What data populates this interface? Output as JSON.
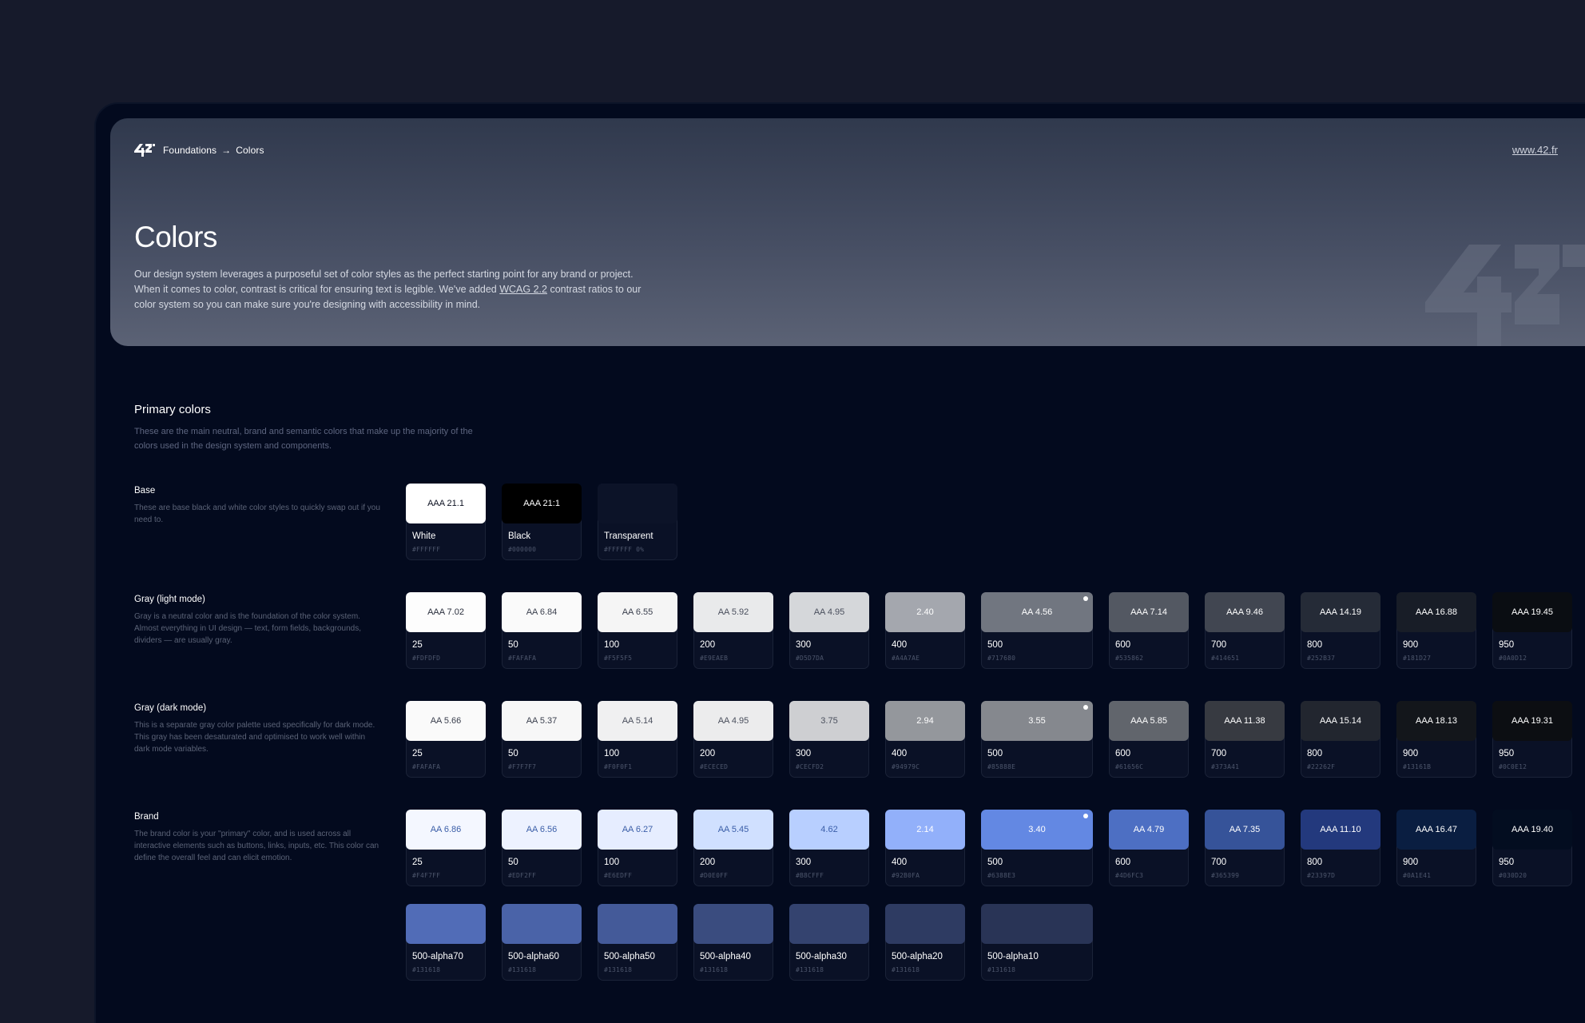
{
  "header": {
    "breadcrumb_parent": "Foundations",
    "breadcrumb_arrow": "→",
    "breadcrumb_current": "Colors",
    "site_link": "www.42.fr",
    "title": "Colors",
    "description_part1": "Our design system leverages a purposeful set of color styles as the perfect starting point for any brand or project. When it comes to color, contrast is critical for ensuring text is legible. We've added ",
    "description_link": "WCAG 2.2",
    "description_part2": " contrast ratios to our color system so you can make sure you're designing with accessibility in mind."
  },
  "primary": {
    "title": "Primary colors",
    "description": "These are the main neutral, brand and semantic colors that make up the majority of the colors used in the design system and components."
  },
  "groups": [
    {
      "key": "base",
      "title": "Base",
      "description": "These are base black and white color styles to quickly swap out if you need to.",
      "swatches": [
        {
          "name": "White",
          "hex": "#FFFFFF",
          "contrast": "AAA 21.1",
          "bg": "#FFFFFF",
          "fg": "#0b1020"
        },
        {
          "name": "Black",
          "hex": "#000000",
          "contrast": "AAA 21:1",
          "bg": "#000000",
          "fg": "#ffffff"
        },
        {
          "name": "Transparent",
          "hex": "#FFFFFF 0%",
          "contrast": "",
          "bg": "transparent",
          "fg": "#ffffff"
        }
      ]
    },
    {
      "key": "gray-light",
      "title": "Gray (light mode)",
      "description": "Gray is a neutral color and is the foundation of the color system. Almost everything in UI design — text, form fields, backgrounds, dividers — are usually gray.",
      "swatches": [
        {
          "name": "25",
          "hex": "#FDFDFD",
          "contrast": "AAA 7.02",
          "bg": "#FDFDFD",
          "fg": "#2a2f3d"
        },
        {
          "name": "50",
          "hex": "#FAFAFA",
          "contrast": "AA 6.84",
          "bg": "#FAFAFA",
          "fg": "#3a3f4d"
        },
        {
          "name": "100",
          "hex": "#F5F5F5",
          "contrast": "AA 6.55",
          "bg": "#F5F5F5",
          "fg": "#3a3f4d"
        },
        {
          "name": "200",
          "hex": "#E9EAEB",
          "contrast": "AA 5.92",
          "bg": "#E9EAEB",
          "fg": "#4a4f5d"
        },
        {
          "name": "300",
          "hex": "#D5D7DA",
          "contrast": "AA 4.95",
          "bg": "#D5D7DA",
          "fg": "#4a4f5d"
        },
        {
          "name": "400",
          "hex": "#A4A7AE",
          "contrast": "2.40",
          "bg": "#A4A7AE",
          "fg": "#ffffff"
        },
        {
          "name": "500",
          "hex": "#717680",
          "contrast": "AA 4.56",
          "bg": "#717680",
          "fg": "#ffffff",
          "dot": true
        },
        {
          "name": "600",
          "hex": "#535862",
          "contrast": "AAA 7.14",
          "bg": "#535862",
          "fg": "#ffffff"
        },
        {
          "name": "700",
          "hex": "#414651",
          "contrast": "AAA 9.46",
          "bg": "#414651",
          "fg": "#ffffff"
        },
        {
          "name": "800",
          "hex": "#252B37",
          "contrast": "AAA 14.19",
          "bg": "#252B37",
          "fg": "#ffffff"
        },
        {
          "name": "900",
          "hex": "#181D27",
          "contrast": "AAA 16.88",
          "bg": "#181D27",
          "fg": "#ffffff"
        },
        {
          "name": "950",
          "hex": "#0A0D12",
          "contrast": "AAA 19.45",
          "bg": "#0A0D12",
          "fg": "#ffffff"
        }
      ]
    },
    {
      "key": "gray-dark",
      "title": "Gray (dark mode)",
      "description": "This is a separate gray color palette used specifically for dark mode. This gray has been desaturated and optimised to work well within dark mode variables.",
      "swatches": [
        {
          "name": "25",
          "hex": "#FAFAFA",
          "contrast": "AA 5.66",
          "bg": "#FAFAFA",
          "fg": "#3a3f4d"
        },
        {
          "name": "50",
          "hex": "#F7F7F7",
          "contrast": "AA 5.37",
          "bg": "#F7F7F7",
          "fg": "#3a3f4d"
        },
        {
          "name": "100",
          "hex": "#F0F0F1",
          "contrast": "AA 5.14",
          "bg": "#F0F0F1",
          "fg": "#4a4f5d"
        },
        {
          "name": "200",
          "hex": "#ECECED",
          "contrast": "AA 4.95",
          "bg": "#ECECED",
          "fg": "#4a4f5d"
        },
        {
          "name": "300",
          "hex": "#CECFD2",
          "contrast": "3.75",
          "bg": "#CECFD2",
          "fg": "#4a4f5d"
        },
        {
          "name": "400",
          "hex": "#94979C",
          "contrast": "2.94",
          "bg": "#94979C",
          "fg": "#ffffff"
        },
        {
          "name": "500",
          "hex": "#85888E",
          "contrast": "3.55",
          "bg": "#85888E",
          "fg": "#ffffff",
          "dot": true
        },
        {
          "name": "600",
          "hex": "#61656C",
          "contrast": "AAA 5.85",
          "bg": "#61656C",
          "fg": "#ffffff"
        },
        {
          "name": "700",
          "hex": "#373A41",
          "contrast": "AAA 11.38",
          "bg": "#373A41",
          "fg": "#ffffff"
        },
        {
          "name": "800",
          "hex": "#22262F",
          "contrast": "AAA 15.14",
          "bg": "#22262F",
          "fg": "#ffffff"
        },
        {
          "name": "900",
          "hex": "#13161B",
          "contrast": "AAA 18.13",
          "bg": "#13161B",
          "fg": "#ffffff"
        },
        {
          "name": "950",
          "hex": "#0C0E12",
          "contrast": "AAA 19.31",
          "bg": "#0C0E12",
          "fg": "#ffffff"
        }
      ]
    },
    {
      "key": "brand",
      "title": "Brand",
      "description": "The brand color is your \"primary\" color, and is used across all interactive elements such as buttons, links, inputs, etc. This color can define the overall feel and can elicit emotion.",
      "swatches": [
        {
          "name": "25",
          "hex": "#F4F7FF",
          "contrast": "AA 6.86",
          "bg": "#F4F7FF",
          "fg": "#3b5ea8"
        },
        {
          "name": "50",
          "hex": "#EDF2FF",
          "contrast": "AA 6.56",
          "bg": "#EDF2FF",
          "fg": "#3b5ea8"
        },
        {
          "name": "100",
          "hex": "#E6EDFF",
          "contrast": "AA 6.27",
          "bg": "#E6EDFF",
          "fg": "#3b5ea8"
        },
        {
          "name": "200",
          "hex": "#D0E0FF",
          "contrast": "AA 5.45",
          "bg": "#D0E0FF",
          "fg": "#3b5ea8"
        },
        {
          "name": "300",
          "hex": "#B8CFFF",
          "contrast": "4.62",
          "bg": "#B8CFFF",
          "fg": "#3b5ea8"
        },
        {
          "name": "400",
          "hex": "#92B0FA",
          "contrast": "2.14",
          "bg": "#92B0FA",
          "fg": "#ffffff"
        },
        {
          "name": "500",
          "hex": "#6388E3",
          "contrast": "3.40",
          "bg": "#6388E3",
          "fg": "#ffffff",
          "dot": true
        },
        {
          "name": "600",
          "hex": "#4D6FC3",
          "contrast": "AA 4.79",
          "bg": "#4D6FC3",
          "fg": "#ffffff"
        },
        {
          "name": "700",
          "hex": "#365399",
          "contrast": "AA 7.35",
          "bg": "#365399",
          "fg": "#ffffff"
        },
        {
          "name": "800",
          "hex": "#23397D",
          "contrast": "AAA 11.10",
          "bg": "#23397D",
          "fg": "#ffffff"
        },
        {
          "name": "900",
          "hex": "#0A1E41",
          "contrast": "AAA 16.47",
          "bg": "#0A1E41",
          "fg": "#ffffff"
        },
        {
          "name": "950",
          "hex": "#030D20",
          "contrast": "AAA 19.40",
          "bg": "#030D20",
          "fg": "#ffffff"
        }
      ]
    }
  ],
  "alpha_swatches": [
    {
      "name": "500-alpha70",
      "hex": "#131618",
      "bg": "#516cb7"
    },
    {
      "name": "500-alpha60",
      "hex": "#131618",
      "bg": "#4a63a8"
    },
    {
      "name": "500-alpha50",
      "hex": "#131618",
      "bg": "#445a99"
    },
    {
      "name": "500-alpha40",
      "hex": "#131618",
      "bg": "#3a4c7f"
    },
    {
      "name": "500-alpha30",
      "hex": "#131618",
      "bg": "#34436f"
    },
    {
      "name": "500-alpha20",
      "hex": "#131618",
      "bg": "#2e3b62"
    },
    {
      "name": "500-alpha10",
      "hex": "#131618",
      "bg": "#293456"
    }
  ],
  "colors": {
    "page_bg": "#161a2b",
    "frame_bg": "#030a1e",
    "card_bg": "#0a1126"
  }
}
